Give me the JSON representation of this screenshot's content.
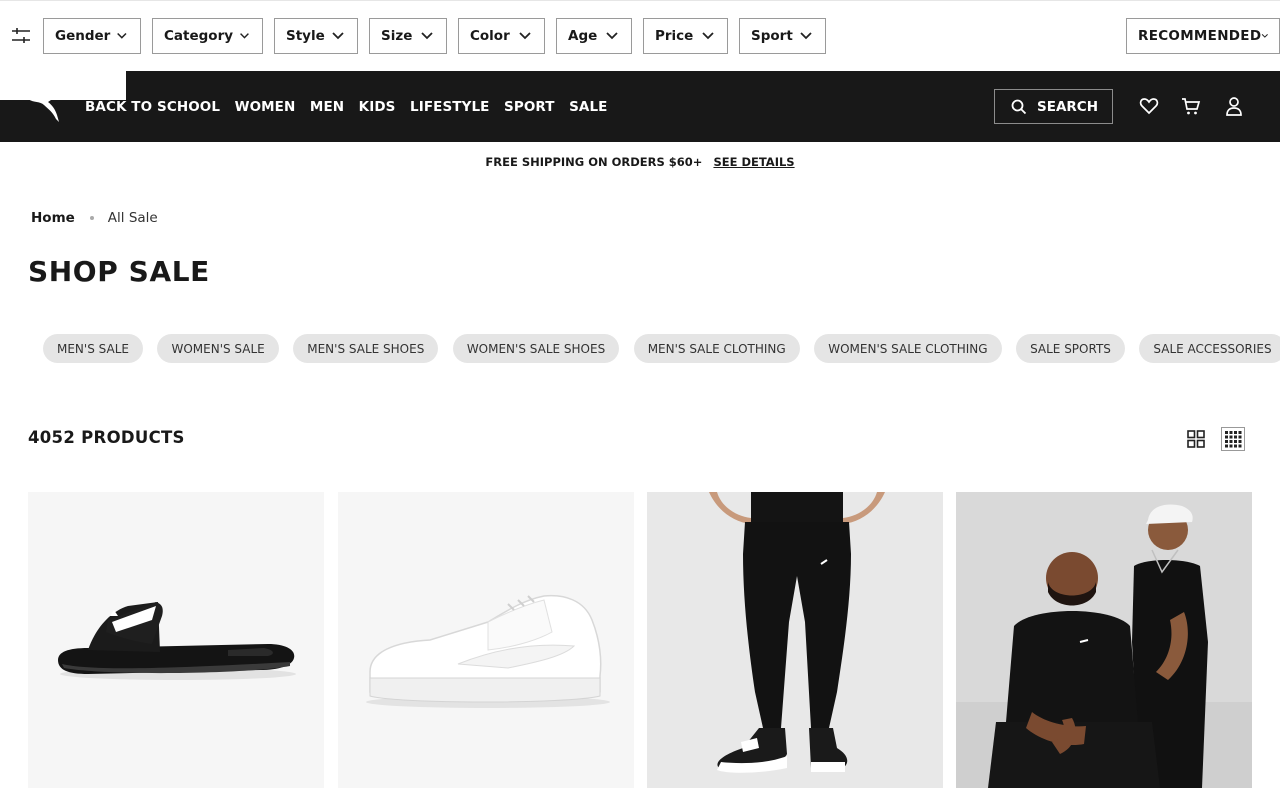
{
  "filters": {
    "items": [
      {
        "label": "Gender"
      },
      {
        "label": "Category"
      },
      {
        "label": "Style"
      },
      {
        "label": "Size"
      },
      {
        "label": "Color"
      },
      {
        "label": "Age"
      },
      {
        "label": "Price"
      },
      {
        "label": "Sport"
      }
    ],
    "sort_label": "RECOMMENDED",
    "toggle_icon": "sliders-icon"
  },
  "nav": {
    "logo": "puma-cat-logo",
    "links": [
      "BACK TO SCHOOL",
      "WOMEN",
      "MEN",
      "KIDS",
      "LIFESTYLE",
      "SPORT",
      "SALE"
    ],
    "search_label": "SEARCH",
    "icons": [
      "heart-icon",
      "cart-icon",
      "account-icon"
    ]
  },
  "promo": {
    "text": "FREE SHIPPING ON ORDERS $60+",
    "link": "SEE DETAILS"
  },
  "breadcrumb": {
    "home": "Home",
    "current": "All Sale"
  },
  "page": {
    "title": "SHOP SALE",
    "product_count": "4052 PRODUCTS"
  },
  "chips": [
    "MEN'S SALE",
    "WOMEN'S SALE",
    "MEN'S SALE SHOES",
    "WOMEN'S SALE SHOES",
    "MEN'S SALE CLOTHING",
    "WOMEN'S SALE CLOTHING",
    "SALE SPORTS",
    "SALE ACCESSORIES"
  ],
  "view_toggles": [
    "grid-2x2-icon",
    "grid-4x4-icon"
  ],
  "products": [
    {
      "image": "black-slide-sandal"
    },
    {
      "image": "white-sneaker"
    },
    {
      "image": "black-joggers-model"
    },
    {
      "image": "two-models-black-tees"
    }
  ],
  "colors": {
    "nav_bg": "#181818",
    "chip_bg": "#e5e5e5",
    "text": "#191919"
  }
}
